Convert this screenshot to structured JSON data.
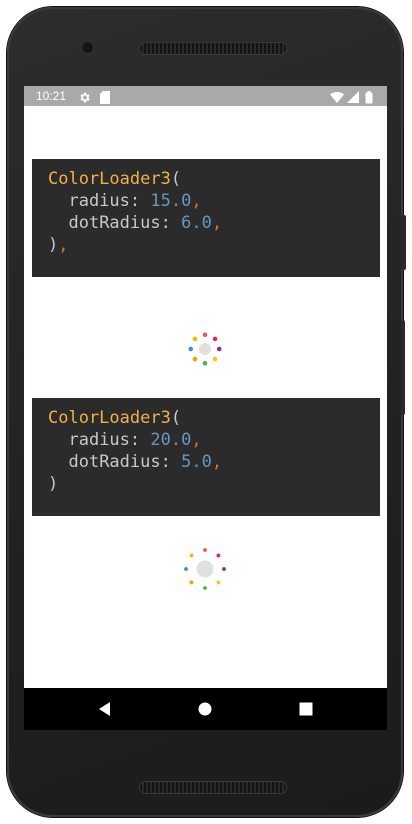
{
  "status_bar": {
    "time": "10:21",
    "icons": [
      "gear-icon",
      "sim-card-icon",
      "wifi-icon",
      "cell-signal-icon",
      "battery-icon"
    ]
  },
  "examples": [
    {
      "class_name": "ColorLoader3",
      "open_paren": "(",
      "params": [
        {
          "name": "radius",
          "value": "15.0"
        },
        {
          "name": "dotRadius",
          "value": "6.0"
        }
      ],
      "closing": ")",
      "closing_comma": ",",
      "loader": {
        "radius": 15.0,
        "dotRadius": 6.0
      }
    },
    {
      "class_name": "ColorLoader3",
      "open_paren": "(",
      "params": [
        {
          "name": "radius",
          "value": "20.0"
        },
        {
          "name": "dotRadius",
          "value": "5.0"
        }
      ],
      "closing": ")",
      "closing_comma": "",
      "loader": {
        "radius": 20.0,
        "dotRadius": 5.0
      }
    }
  ],
  "code_syntax": {
    "colon": ":",
    "comma": ","
  },
  "loader_colors": [
    "#ef5350",
    "#e91e63",
    "#8e24aa",
    "#fbc02d",
    "#4caf50",
    "#ff9800",
    "#4285f4",
    "#ffb300"
  ],
  "colors": {
    "code_background": "#2b2b2b",
    "class_color": "#f0b14a",
    "number_color": "#6897bb",
    "comma_color": "#cc7832",
    "status_bar": "#a9a9a9",
    "nav_bar": "#000000"
  },
  "nav_bar": {
    "buttons": [
      "back-icon",
      "home-icon",
      "recents-icon"
    ]
  }
}
